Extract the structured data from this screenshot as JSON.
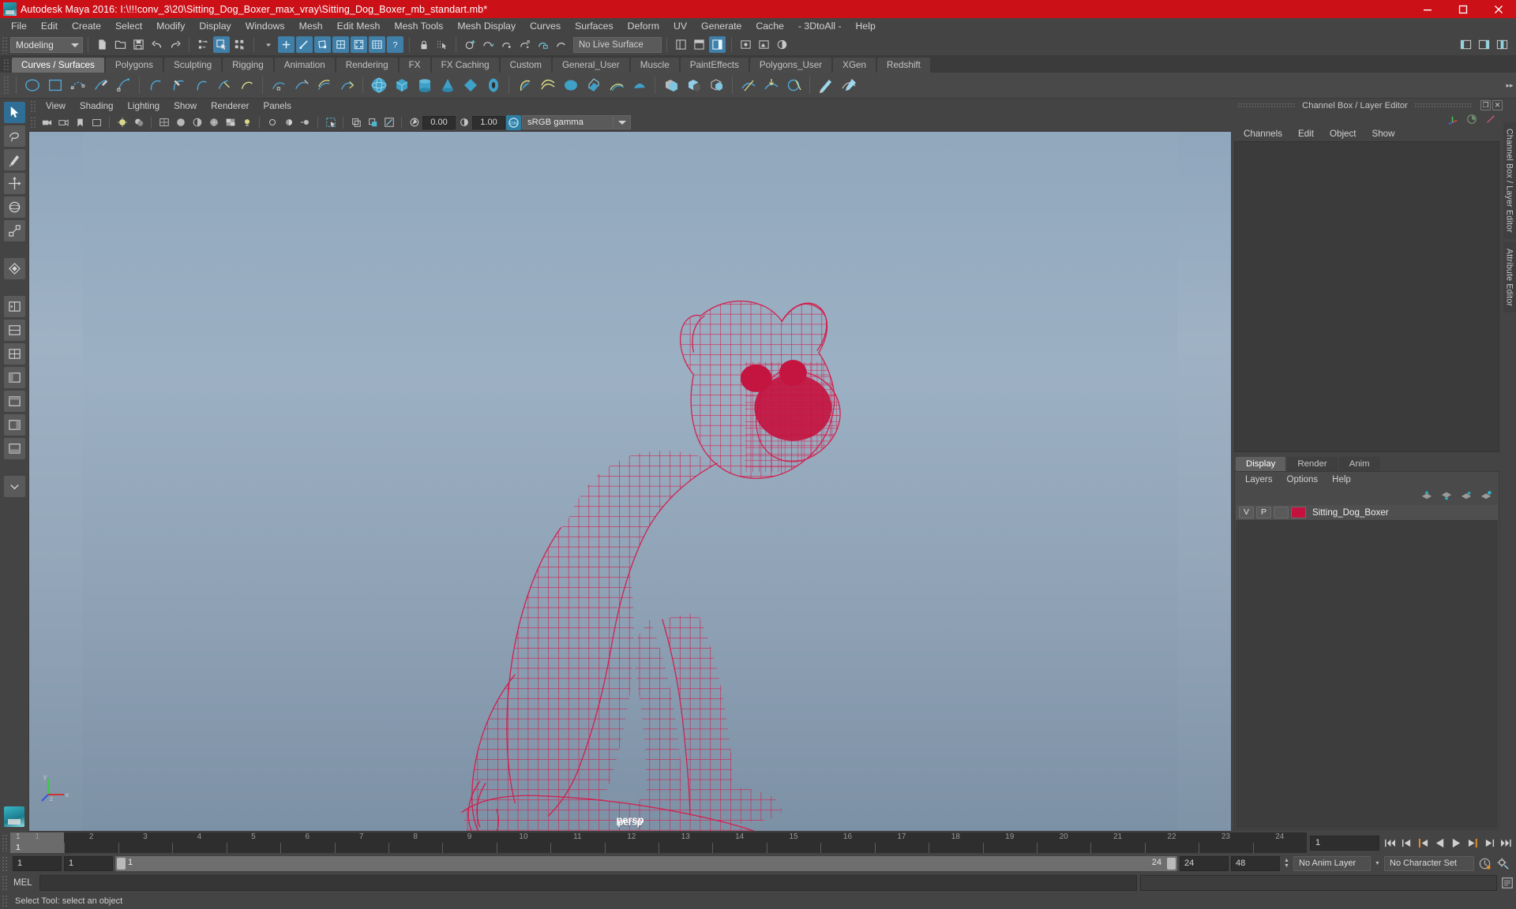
{
  "window": {
    "title": "Autodesk Maya 2016: I:\\!!!conv_3\\20\\Sitting_Dog_Boxer_max_vray\\Sitting_Dog_Boxer_mb_standart.mb*",
    "minimize_label": "—",
    "maximize_label": "❐",
    "close_label": "✕",
    "titlebar_color": "#cc1018"
  },
  "menubar": {
    "items": [
      {
        "label": "File"
      },
      {
        "label": "Edit"
      },
      {
        "label": "Create"
      },
      {
        "label": "Select"
      },
      {
        "label": "Modify"
      },
      {
        "label": "Display"
      },
      {
        "label": "Windows"
      },
      {
        "label": "Mesh"
      },
      {
        "label": "Edit Mesh"
      },
      {
        "label": "Mesh Tools"
      },
      {
        "label": "Mesh Display"
      },
      {
        "label": "Curves"
      },
      {
        "label": "Surfaces"
      },
      {
        "label": "Deform"
      },
      {
        "label": "UV"
      },
      {
        "label": "Generate"
      },
      {
        "label": "Cache"
      },
      {
        "label": "- 3DtoAll -"
      },
      {
        "label": "Help"
      }
    ]
  },
  "statusbar": {
    "mode_value": "Modeling",
    "live_surface_value": "No Live Surface"
  },
  "shelf": {
    "tabs": [
      {
        "label": "Curves / Surfaces",
        "active": true
      },
      {
        "label": "Polygons",
        "active": false
      },
      {
        "label": "Sculpting",
        "active": false
      },
      {
        "label": "Rigging",
        "active": false
      },
      {
        "label": "Animation",
        "active": false
      },
      {
        "label": "Rendering",
        "active": false
      },
      {
        "label": "FX",
        "active": false
      },
      {
        "label": "FX Caching",
        "active": false
      },
      {
        "label": "Custom",
        "active": false
      },
      {
        "label": "General_User",
        "active": false
      },
      {
        "label": "Muscle",
        "active": false
      },
      {
        "label": "PaintEffects",
        "active": false
      },
      {
        "label": "Polygons_User",
        "active": false
      },
      {
        "label": "XGen",
        "active": false
      },
      {
        "label": "Redshift",
        "active": false
      }
    ]
  },
  "viewport": {
    "menu": [
      {
        "label": "View"
      },
      {
        "label": "Shading"
      },
      {
        "label": "Lighting"
      },
      {
        "label": "Show"
      },
      {
        "label": "Renderer"
      },
      {
        "label": "Panels"
      }
    ],
    "exposure_value": "0.00",
    "gamma_value": "1.00",
    "color_management_value": "sRGB gamma",
    "camera_label": "persp",
    "model_name": "Sitting_Dog_Boxer",
    "wireframe_color": "#d61a4a",
    "background_top": "#8fa6bc",
    "background_bottom": "#7f93a7"
  },
  "channel_box": {
    "title": "Channel Box / Layer Editor",
    "menu": [
      {
        "label": "Channels"
      },
      {
        "label": "Edit"
      },
      {
        "label": "Object"
      },
      {
        "label": "Show"
      }
    ]
  },
  "layer_editor": {
    "tabs": [
      {
        "label": "Display",
        "active": true
      },
      {
        "label": "Render",
        "active": false
      },
      {
        "label": "Anim",
        "active": false
      }
    ],
    "menu": [
      {
        "label": "Layers"
      },
      {
        "label": "Options"
      },
      {
        "label": "Help"
      }
    ],
    "layers": [
      {
        "visibility": "V",
        "playback": "P",
        "shading": "",
        "color": "#c4123f",
        "name": "Sitting_Dog_Boxer"
      }
    ]
  },
  "vertical_tabs": [
    {
      "label": "Channel Box / Layer Editor"
    },
    {
      "label": "Attribute Editor"
    }
  ],
  "timeline": {
    "start_frame": "1",
    "end_frame": "24",
    "current_frame": "1",
    "current_frame_field": "1",
    "ticks": [
      "1",
      "2",
      "3",
      "4",
      "5",
      "6",
      "7",
      "8",
      "9",
      "10",
      "11",
      "12",
      "13",
      "14",
      "15",
      "16",
      "17",
      "18",
      "19",
      "20",
      "21",
      "22",
      "23",
      "24"
    ],
    "playback_buttons": [
      {
        "name": "go-to-start"
      },
      {
        "name": "step-back-frame"
      },
      {
        "name": "step-back-key"
      },
      {
        "name": "play-backwards"
      },
      {
        "name": "play-forwards"
      },
      {
        "name": "step-forward-key"
      },
      {
        "name": "step-forward-frame"
      },
      {
        "name": "go-to-end"
      }
    ]
  },
  "range_bar": {
    "anim_start": "1",
    "range_start": "1",
    "slider_start_label": "1",
    "slider_end_label": "24",
    "range_end": "24",
    "anim_end": "48",
    "anim_layer_value": "No Anim Layer",
    "character_set_value": "No Character Set"
  },
  "command_line": {
    "language_label": "MEL",
    "input_value": "",
    "output_value": ""
  },
  "help_line": {
    "message": "Select Tool: select an object"
  }
}
